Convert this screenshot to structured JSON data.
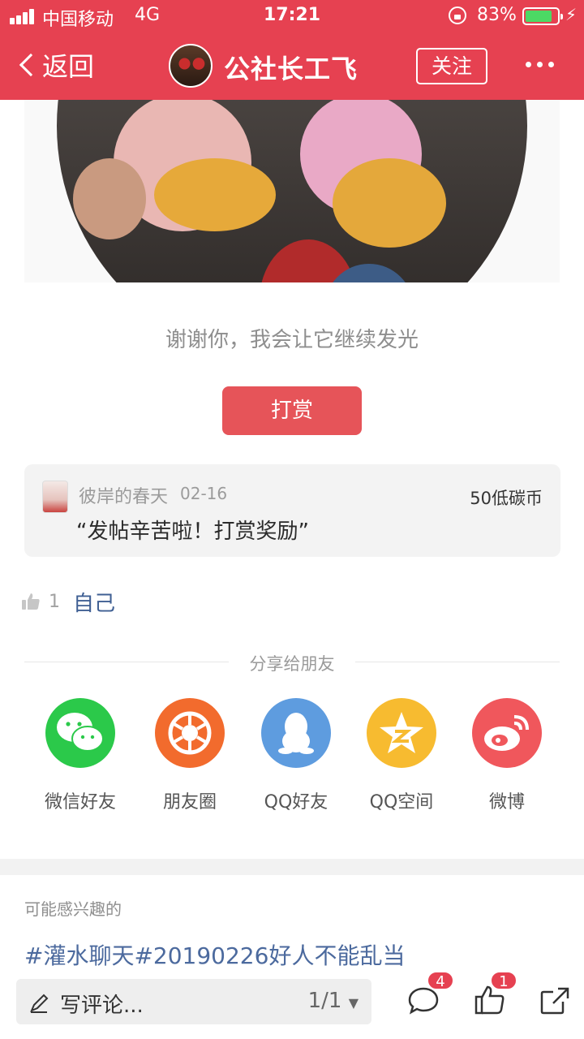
{
  "status_bar": {
    "carrier": "中国移动",
    "network": "4G",
    "time": "17:21",
    "battery_pct": "83%",
    "battery_level": 0.83
  },
  "nav": {
    "back_label": "返回",
    "title": "公社长工飞",
    "follow_label": "关注"
  },
  "thanks_text": "谢谢你，我会让它继续发光",
  "reward_button": "打赏",
  "reward_record": {
    "user": "彼岸的春天",
    "date": "02-16",
    "amount": "50低碳币",
    "message": "“发帖辛苦啦！打赏奖励”"
  },
  "likes": {
    "count": "1",
    "users": "自己"
  },
  "share": {
    "title": "分享给朋友",
    "items": [
      {
        "label": "微信好友",
        "icon": "wechat-icon",
        "color": "#2bc94a"
      },
      {
        "label": "朋友圈",
        "icon": "moments-icon",
        "color": "#f26b2d"
      },
      {
        "label": "QQ好友",
        "icon": "qq-icon",
        "color": "#5e9cdf"
      },
      {
        "label": "QQ空间",
        "icon": "qzone-icon",
        "color": "#f7bb30"
      },
      {
        "label": "微博",
        "icon": "weibo-icon",
        "color": "#f0575c"
      }
    ]
  },
  "interest": {
    "label": "可能感兴趣的",
    "topic": "#灌水聊天#20190226好人不能乱当"
  },
  "bottom_bar": {
    "comment_placeholder": "写评论...",
    "page_indicator": "1/1",
    "comment_count": "4",
    "like_count": "1"
  },
  "colors": {
    "brand": "#e64151",
    "link": "#3f5f93"
  }
}
